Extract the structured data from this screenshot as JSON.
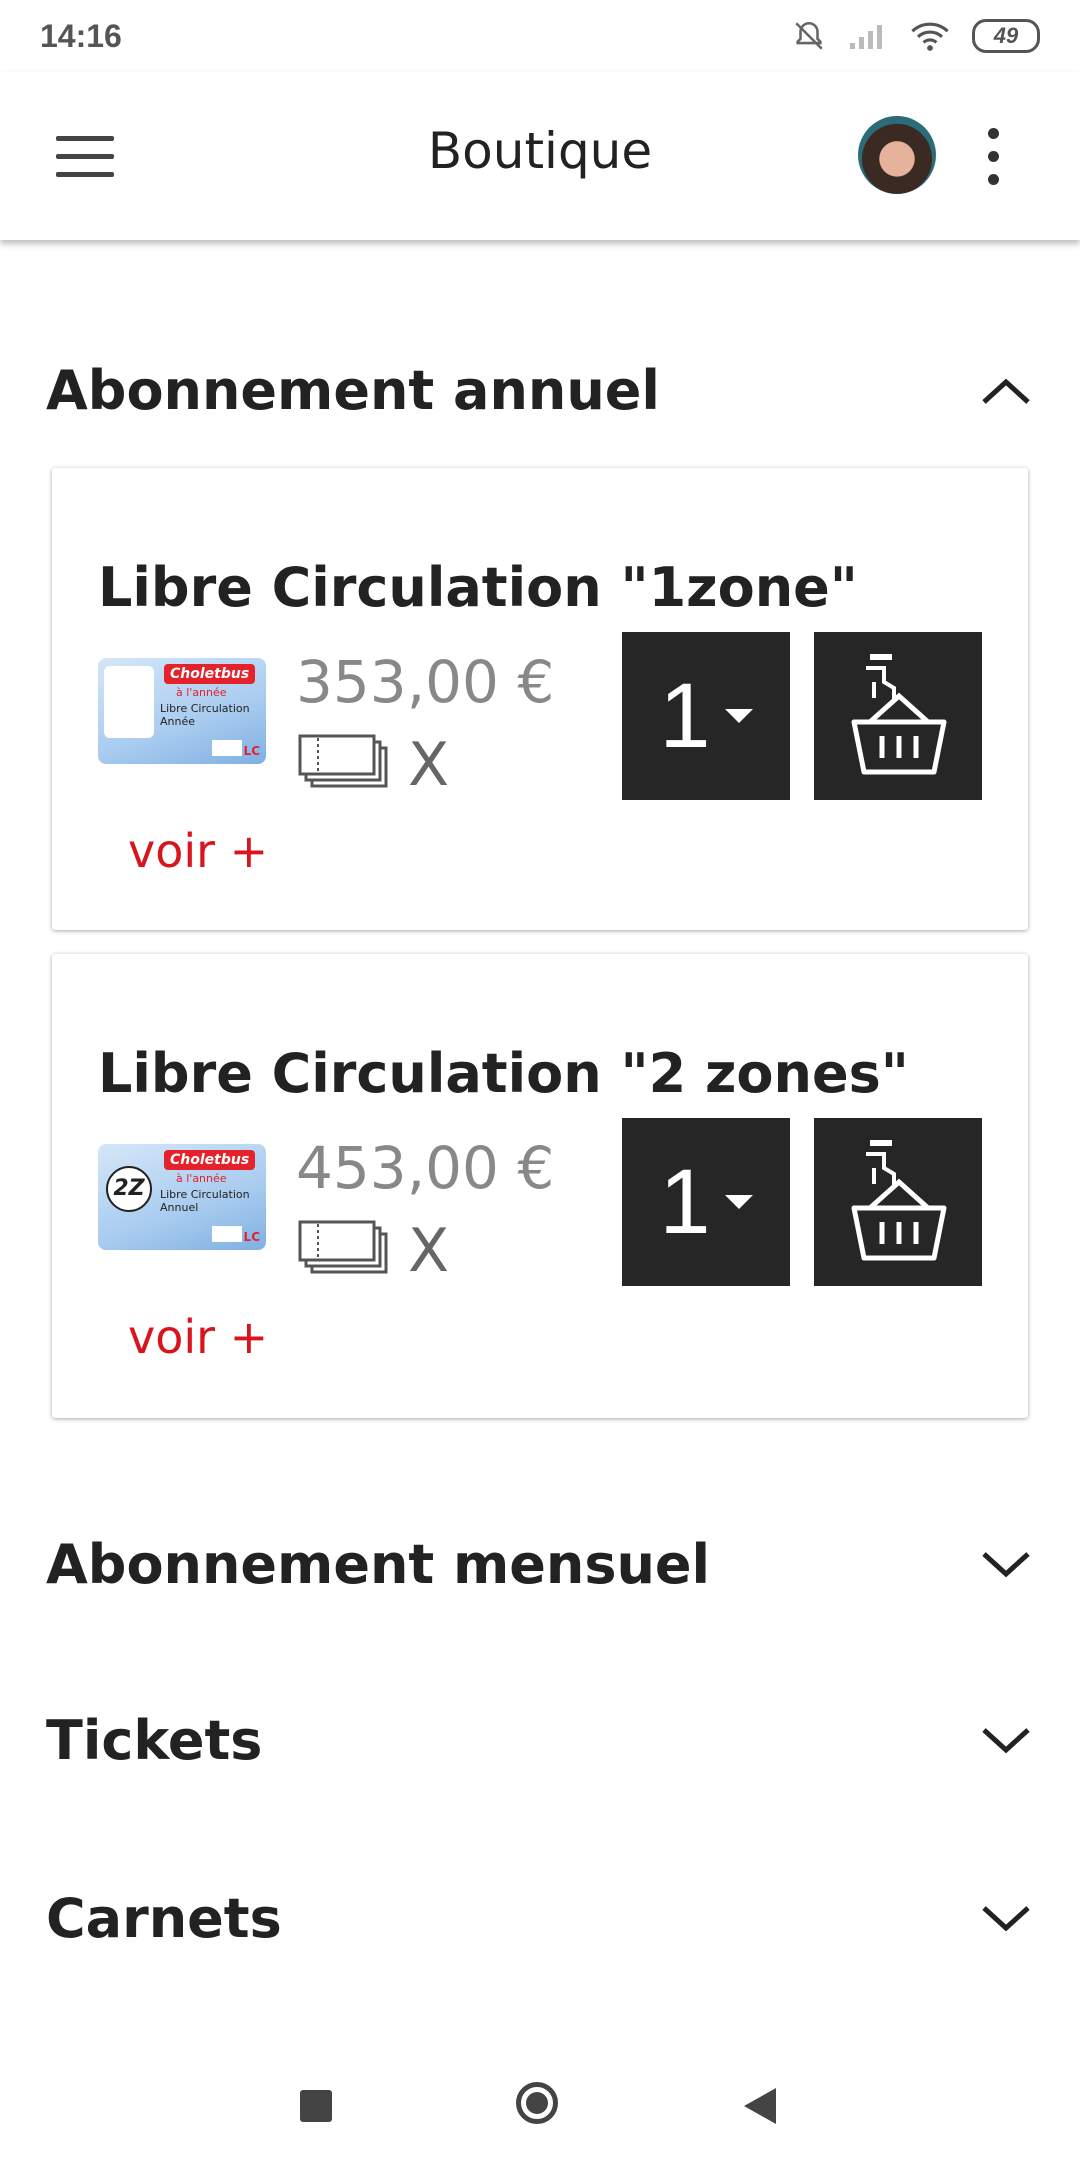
{
  "status": {
    "time": "14:16",
    "battery": "49"
  },
  "appbar": {
    "title": "Boutique"
  },
  "sections": [
    {
      "label": "Abonnement annuel",
      "expanded": true
    },
    {
      "label": "Abonnement mensuel",
      "expanded": false
    },
    {
      "label": "Tickets",
      "expanded": false
    },
    {
      "label": "Carnets",
      "expanded": false
    }
  ],
  "products": [
    {
      "name": "Libre Circulation \"1zone\"",
      "price": "353,00 €",
      "quantity": "1",
      "x_label": "X",
      "more_label": "voir +",
      "card": {
        "brand": "Choletbus",
        "subtitle": "à l'année",
        "text": "Libre Circulation Année",
        "badge": "LC"
      }
    },
    {
      "name": "Libre Circulation \"2 zones\"",
      "price": "453,00 €",
      "quantity": "1",
      "x_label": "X",
      "more_label": "voir +",
      "card": {
        "brand": "Choletbus",
        "subtitle": "à l'année",
        "text": "Libre Circulation Annuel",
        "badge": "LC",
        "zone": "2Z"
      }
    }
  ],
  "colors": {
    "accent_red": "#d9141c",
    "dark_button": "#262626",
    "text": "#222222"
  }
}
